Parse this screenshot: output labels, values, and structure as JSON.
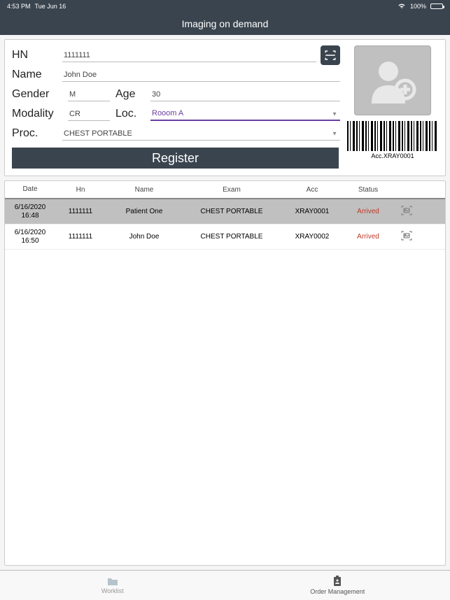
{
  "status_bar": {
    "time": "4:53 PM",
    "date": "Tue Jun 16",
    "battery": "100%"
  },
  "title": "Imaging on demand",
  "form": {
    "labels": {
      "hn": "HN",
      "name": "Name",
      "gender": "Gender",
      "age": "Age",
      "modality": "Modality",
      "loc": "Loc.",
      "proc": "Proc."
    },
    "values": {
      "hn": "1111111",
      "name": "John Doe",
      "gender": "M",
      "age": "30",
      "modality": "CR",
      "loc": "Rooom A",
      "proc": "CHEST PORTABLE"
    },
    "register_label": "Register",
    "barcode_label": "Acc.XRAY0001"
  },
  "table": {
    "headers": {
      "date": "Date",
      "hn": "Hn",
      "name": "Name",
      "exam": "Exam",
      "acc": "Acc",
      "status": "Status"
    },
    "rows": [
      {
        "date": "6/16/2020 16:48",
        "hn": "1111111",
        "name": "Patient One",
        "exam": "CHEST PORTABLE",
        "acc": "XRAY0001",
        "status": "Arrived",
        "selected": true
      },
      {
        "date": "6/16/2020 16:50",
        "hn": "1111111",
        "name": "John Doe",
        "exam": "CHEST PORTABLE",
        "acc": "XRAY0002",
        "status": "Arrived",
        "selected": false
      }
    ]
  },
  "tabs": {
    "worklist": "Worklist",
    "order": "Order Management"
  }
}
